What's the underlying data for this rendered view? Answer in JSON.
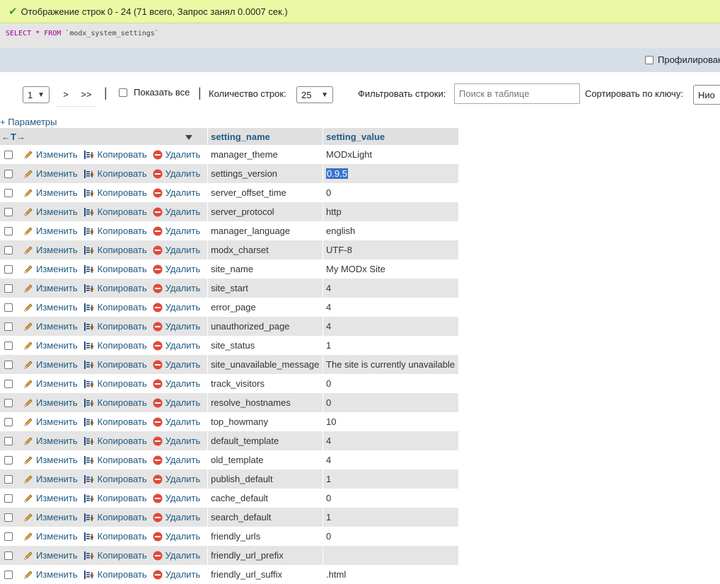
{
  "status": {
    "message": "Отображение строк 0 - 24 (71 всего, Запрос занял 0.0007 сек.)"
  },
  "query": {
    "keyword_select": "SELECT",
    "star": "*",
    "keyword_from": "FROM",
    "table": "`modx_system_settings`"
  },
  "profiling": {
    "label": "Профилирование"
  },
  "navigation": {
    "page_value": "1",
    "next_label": ">",
    "last_label": ">>",
    "show_all_label": "Показать все",
    "row_count_label": "Количество строк:",
    "row_count_value": "25",
    "filter_label": "Фильтровать строки:",
    "filter_placeholder": "Поиск в таблице",
    "sort_label": "Сортировать по ключу:",
    "sort_value": "Нио"
  },
  "options_link": "+ Параметры",
  "table": {
    "arrows": "←T→",
    "columns": [
      "setting_name",
      "setting_value"
    ],
    "actions": {
      "edit": "Изменить",
      "copy": "Копировать",
      "delete": "Удалить"
    },
    "rows": [
      {
        "name": "manager_theme",
        "value": "MODxLight"
      },
      {
        "name": "settings_version",
        "value": "0.9.5",
        "selected": true
      },
      {
        "name": "server_offset_time",
        "value": "0"
      },
      {
        "name": "server_protocol",
        "value": "http"
      },
      {
        "name": "manager_language",
        "value": "english"
      },
      {
        "name": "modx_charset",
        "value": "UTF-8"
      },
      {
        "name": "site_name",
        "value": "My MODx Site"
      },
      {
        "name": "site_start",
        "value": "4"
      },
      {
        "name": "error_page",
        "value": "4"
      },
      {
        "name": "unauthorized_page",
        "value": "4"
      },
      {
        "name": "site_status",
        "value": "1"
      },
      {
        "name": "site_unavailable_message",
        "value": "The site is currently unavailable"
      },
      {
        "name": "track_visitors",
        "value": "0"
      },
      {
        "name": "resolve_hostnames",
        "value": "0"
      },
      {
        "name": "top_howmany",
        "value": "10"
      },
      {
        "name": "default_template",
        "value": "4"
      },
      {
        "name": "old_template",
        "value": "4"
      },
      {
        "name": "publish_default",
        "value": "1"
      },
      {
        "name": "cache_default",
        "value": "0"
      },
      {
        "name": "search_default",
        "value": "1"
      },
      {
        "name": "friendly_urls",
        "value": "0"
      },
      {
        "name": "friendly_url_prefix",
        "value": ""
      },
      {
        "name": "friendly_url_suffix",
        "value": ".html"
      }
    ]
  },
  "colors": {
    "success_bg": "#ebf8a4",
    "link": "#235a81",
    "row_alt": "#e5e5e5",
    "selection": "#3a73c9"
  }
}
